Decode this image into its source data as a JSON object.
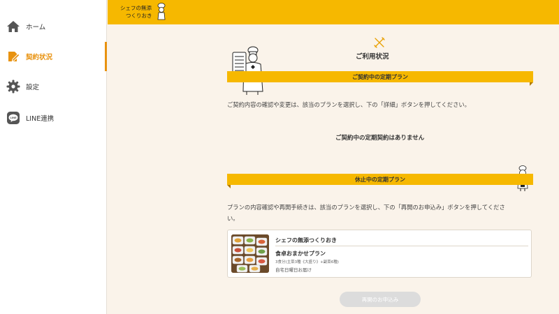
{
  "sidebar": {
    "items": [
      {
        "label": "ホーム",
        "icon": "home-icon"
      },
      {
        "label": "契約状況",
        "icon": "contract-icon",
        "active": true
      },
      {
        "label": "設定",
        "icon": "gear-icon"
      },
      {
        "label": "LINE連携",
        "icon": "line-icon"
      }
    ]
  },
  "header": {
    "logo_line1": "シェフの無添",
    "logo_line2": "つくりおき"
  },
  "main": {
    "title": "ご利用状況",
    "active_section": {
      "title": "ご契約中の定期プラン",
      "description": "ご契約内容の確認や変更は、該当のプランを選択し、下の「詳細」ボタンを押してください。",
      "empty_message": "ご契約中の定期契約はありません"
    },
    "paused_section": {
      "title": "休止中の定期プラン",
      "description_line1": "プランの内容確認や再開手続きは、該当のプランを選択し、下の「再開のお申込み」ボタンを押してくださ",
      "description_line2": "い。",
      "plan": {
        "service": "シェフの無添つくりおき",
        "name": "食卓おまかせプラン",
        "detail": "3食分(主菜3種《大盛り》+副菜6種)",
        "delivery": "自宅日曜日お届け"
      },
      "resume_button": "再開のお申込み"
    }
  },
  "colors": {
    "accent": "#f6b800",
    "active": "#e8920f",
    "background": "#faf3ea"
  }
}
